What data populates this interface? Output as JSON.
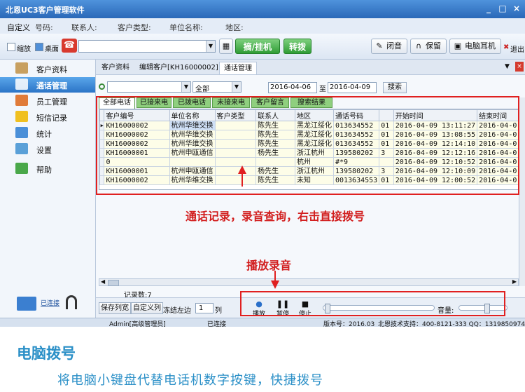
{
  "app": {
    "title": "北恩UC3客户管理软件",
    "window_controls": [
      "_",
      "□",
      "×"
    ]
  },
  "info_row": {
    "customize": "自定义",
    "phone_label": "号码:",
    "contact_label": "联系人:",
    "type_label": "客户类型:",
    "company_label": "单位名称:",
    "area_label": "地区:"
  },
  "toolbar": {
    "shrink_label": "缩放",
    "desktop_label": "桌面",
    "hangup_label": "摘/挂机",
    "transfer_label": "转拨",
    "mute_label": "闭音",
    "hold_label": "保留",
    "headset_label": "电脑耳机",
    "exit_label": "退出"
  },
  "sidebar": {
    "items": [
      {
        "label": "客户资料",
        "icon": "customer-icon",
        "color": "#c8a060"
      },
      {
        "label": "通话管理",
        "icon": "phone-icon",
        "color": "#ffffff",
        "active": true
      },
      {
        "label": "员工管理",
        "icon": "staff-icon",
        "color": "#e07b39"
      },
      {
        "label": "短信记录",
        "icon": "sms-icon",
        "color": "#f0c020"
      },
      {
        "label": "统计",
        "icon": "stats-icon",
        "color": "#4a8fd8"
      },
      {
        "label": "设置",
        "icon": "settings-icon",
        "color": "#5aa0d8"
      },
      {
        "label": "帮助",
        "icon": "help-icon",
        "color": "#4aa84a"
      }
    ],
    "connection_label": "已连接"
  },
  "tabs": [
    "客户资料",
    "编辑客户[KH16000002]",
    "通话管理"
  ],
  "filter": {
    "scope_value": "全部",
    "date_from": "2016-04-06",
    "to_label": "至",
    "date_to": "2016-04-09",
    "search_label": "搜索"
  },
  "subtabs": [
    "全部电话",
    "已接来电",
    "已拨电话",
    "未接来电",
    "客户留言",
    "搜索结果"
  ],
  "grid": {
    "columns": [
      "客户编号",
      "单位名称",
      "客户类型",
      "联系人",
      "地区",
      "通话号码",
      "",
      "开始时间",
      "结束时间"
    ],
    "rows": [
      [
        "KH16000002",
        "杭州华维交换",
        "",
        "陈先生",
        "黑龙江绥化",
        "013634552",
        "01",
        "2016-04-09 13:11:27",
        "2016-04-0"
      ],
      [
        "KH16000002",
        "杭州华维交换",
        "",
        "陈先生",
        "黑龙江绥化",
        "013634552",
        "01",
        "2016-04-09 13:08:55",
        "2016-04-0"
      ],
      [
        "KH16000002",
        "杭州华维交换",
        "",
        "陈先生",
        "黑龙江绥化",
        "013634552",
        "01",
        "2016-04-09 12:14:10",
        "2016-04-0"
      ],
      [
        "KH16000001",
        "杭州申瓯通信",
        "",
        "杨先生",
        "浙江杭州",
        "139580202",
        "3",
        "2016-04-09 12:12:16",
        "2016-04-0"
      ],
      [
        "0",
        "",
        "",
        "",
        "杭州",
        "#*9",
        "",
        "2016-04-09 12:10:52",
        "2016-04-0"
      ],
      [
        "KH16000001",
        "杭州申瓯通信",
        "",
        "杨先生",
        "浙江杭州",
        "139580202",
        "3",
        "2016-04-09 12:10:09",
        "2016-04-0"
      ],
      [
        "KH16000002",
        "杭州华维交换",
        "",
        "陈先生",
        "未知",
        "0013634553",
        "01",
        "2016-04-09 12:00:52",
        "2016-04-0"
      ]
    ]
  },
  "record_count": "记录数:7",
  "bottom": {
    "save_cols": "保存列宽",
    "custom_cols": "自定义列",
    "freeze_left": "冻结左边",
    "freeze_value": "1",
    "col_suffix": "列",
    "play": "播放",
    "pause": "暂停",
    "stop": "停止",
    "volume": "音量:"
  },
  "status": {
    "user": "Admin[高级管理员]",
    "conn": "已连接",
    "version": "版本号：2016.03",
    "support": "北恩技术支持：400-8121-333 QQ：1319850974"
  },
  "annotations": {
    "grid_note": "通话记录，录音查询，右击直接拨号",
    "player_note": "播放录音"
  },
  "footer": {
    "title": "电脑拨号",
    "subtitle": "将电脑小键盘代替电话机数字按键，快捷拨号"
  },
  "colors": {
    "accent": "#2a8fc7",
    "annotation": "#e02020",
    "green_button": "#2f9c35"
  }
}
